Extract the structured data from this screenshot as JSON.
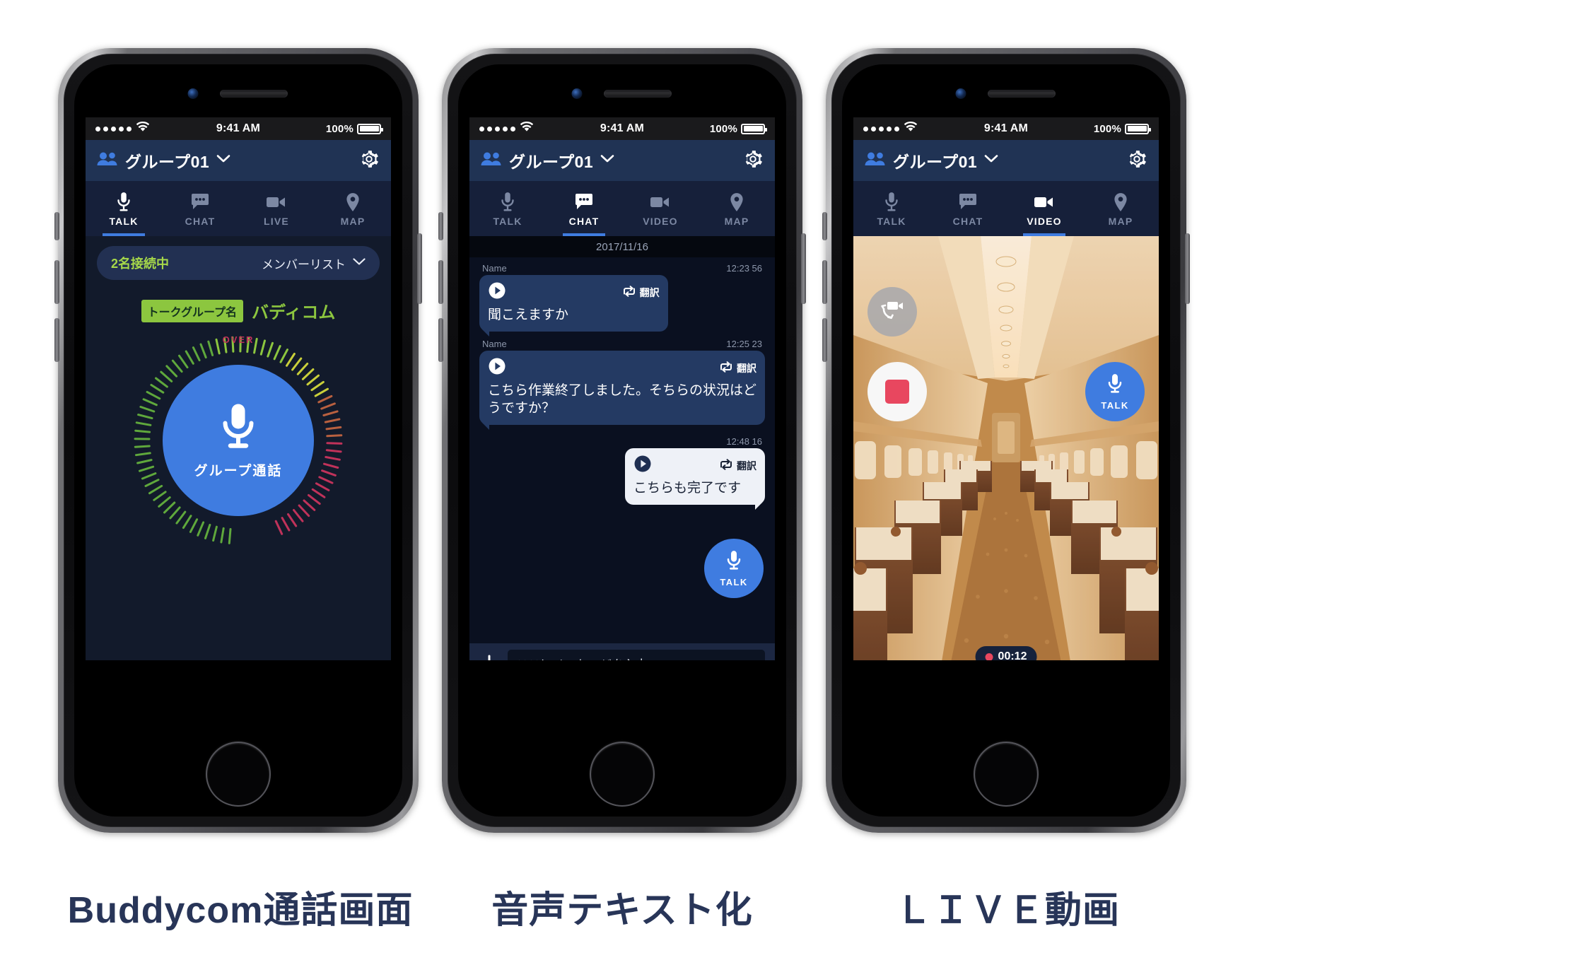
{
  "status_bar": {
    "signal_dots": 5,
    "wifi_icon": "wifi-icon",
    "time": "9:41 AM",
    "battery_percent": "100%"
  },
  "app_bar": {
    "group_icon": "people-icon",
    "group_name": "グループ01",
    "dropdown_icon": "chevron-down-icon",
    "settings_icon": "gear-icon"
  },
  "phones": [
    {
      "key": "talk",
      "caption": "Buddycom通話画面",
      "tabs": [
        {
          "label": "TALK",
          "icon": "microphone-icon",
          "active": true
        },
        {
          "label": "CHAT",
          "icon": "chat-bubble-icon",
          "active": false
        },
        {
          "label": "LIVE",
          "icon": "video-camera-icon",
          "active": false
        },
        {
          "label": "MAP",
          "icon": "map-pin-icon",
          "active": false
        }
      ],
      "talk_screen": {
        "connected_count": "2名接続中",
        "member_list_label": "メンバーリスト",
        "member_list_chevron": "chevron-down-icon",
        "group_name_badge": "トークグループ名",
        "group_name_value": "バディコム",
        "over_label": "OVER",
        "talk_button_label": "グループ通話",
        "talk_button_icon": "microphone-icon"
      }
    },
    {
      "key": "chat",
      "caption": "音声テキスト化",
      "tabs": [
        {
          "label": "TALK",
          "icon": "microphone-icon",
          "active": false
        },
        {
          "label": "CHAT",
          "icon": "chat-bubble-icon",
          "active": true
        },
        {
          "label": "VIDEO",
          "icon": "video-camera-icon",
          "active": false
        },
        {
          "label": "MAP",
          "icon": "map-pin-icon",
          "active": false
        }
      ],
      "chat_screen": {
        "date_separator": "2017/11/16",
        "translate_label": "翻訳",
        "translate_icon": "translate-loop-icon",
        "play_icon": "play-icon",
        "messages": [
          {
            "side": "left",
            "name": "Name",
            "time": "12:23 56",
            "text": "聞こえますか"
          },
          {
            "side": "left",
            "name": "Name",
            "time": "12:25 23",
            "text": "こちら作業終了しました。そちらの状況はどうですか？"
          },
          {
            "side": "right",
            "name": "",
            "time": "12:48 16",
            "text": "こちらも完了です"
          }
        ],
        "fab_talk_label": "TALK",
        "fab_talk_icon": "microphone-icon",
        "add_icon": "plus-icon",
        "input_placeholder": "ここにメッセージを入力"
      }
    },
    {
      "key": "video",
      "caption": "ＬＩＶＥ動画",
      "tabs": [
        {
          "label": "TALK",
          "icon": "microphone-icon",
          "active": false
        },
        {
          "label": "CHAT",
          "icon": "chat-bubble-icon",
          "active": false
        },
        {
          "label": "VIDEO",
          "icon": "video-camera-icon",
          "active": true
        },
        {
          "label": "MAP",
          "icon": "map-pin-icon",
          "active": false
        }
      ],
      "video_screen": {
        "scene_description": "train-interior-photo",
        "flip_camera_icon": "flip-camera-icon",
        "stop_record_icon": "stop-square-icon",
        "talk_label": "TALK",
        "talk_icon": "microphone-icon",
        "record_timer": "00:12",
        "record_dot": "record-dot-icon"
      }
    }
  ],
  "colors": {
    "accent_blue": "#3f7ce0",
    "appbar_blue": "#203354",
    "screen_bg": "#121a2b",
    "green": "#8cc63f",
    "red": "#e8475f",
    "caption_text": "#283558"
  }
}
